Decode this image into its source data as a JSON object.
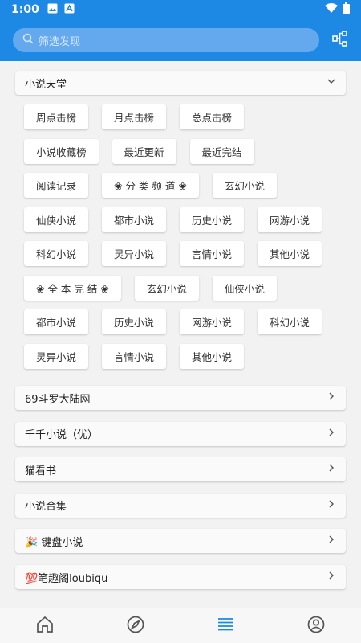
{
  "status": {
    "time": "1:00"
  },
  "search": {
    "placeholder": "筛选发现"
  },
  "group_open": {
    "title": "小说天堂"
  },
  "chip_rows": [
    [
      "周点击榜",
      "月点击榜",
      "总点击榜"
    ],
    [
      "小说收藏榜",
      "最近更新",
      "最近完结"
    ],
    [
      "阅读记录",
      "❀ 分 类 频 道 ❀",
      "玄幻小说"
    ],
    [
      "仙侠小说",
      "都市小说",
      "历史小说",
      "网游小说"
    ],
    [
      "科幻小说",
      "灵异小说",
      "言情小说",
      "其他小说"
    ],
    [
      "❀ 全 本 完 结 ❀",
      "玄幻小说",
      "仙侠小说"
    ],
    [
      "都市小说",
      "历史小说",
      "网游小说",
      "科幻小说"
    ],
    [
      "灵异小说",
      "言情小说",
      "其他小说"
    ]
  ],
  "groups": [
    {
      "title": "69斗罗大陆网"
    },
    {
      "title": "千千小说（优）"
    },
    {
      "title": "猫看书"
    },
    {
      "title": "小说合集"
    },
    {
      "title": "🎉 键盘小说"
    },
    {
      "title": "💯笔趣阁loubiqu"
    }
  ],
  "colors": {
    "primary": "#1e88e5",
    "nav_active": "#1e88e5",
    "nav_inactive": "#555555"
  },
  "bottom_nav": {
    "icons": [
      "home-icon",
      "explore-icon",
      "list-icon",
      "profile-icon"
    ],
    "active": 2
  }
}
